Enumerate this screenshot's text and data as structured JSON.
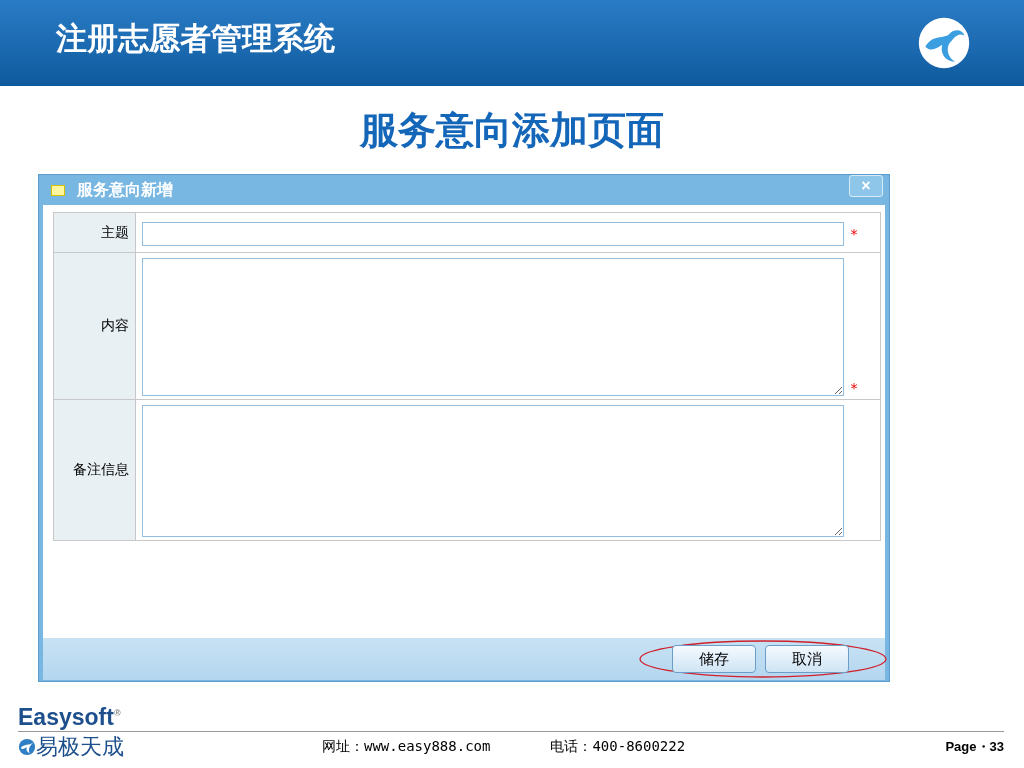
{
  "slide": {
    "title": "注册志愿者管理系统",
    "subtitle": "服务意向添加页面"
  },
  "dialog": {
    "title": "服务意向新增",
    "close": "×",
    "fields": [
      {
        "label": "主题",
        "kind": "input",
        "required": true
      },
      {
        "label": "内容",
        "kind": "textarea",
        "required": true
      },
      {
        "label": "备注信息",
        "kind": "textarea",
        "required": false
      }
    ],
    "required_mark": "*",
    "buttons": [
      {
        "label": "储存",
        "highlighted": true
      },
      {
        "label": "取消",
        "highlighted": true
      }
    ]
  },
  "footer": {
    "brand": "Easysoft",
    "registered": "®",
    "brand_cn": "易极天成",
    "website": "网址：www.easy888.com",
    "phone": "电话：400-8600222",
    "page": "Page・33"
  }
}
